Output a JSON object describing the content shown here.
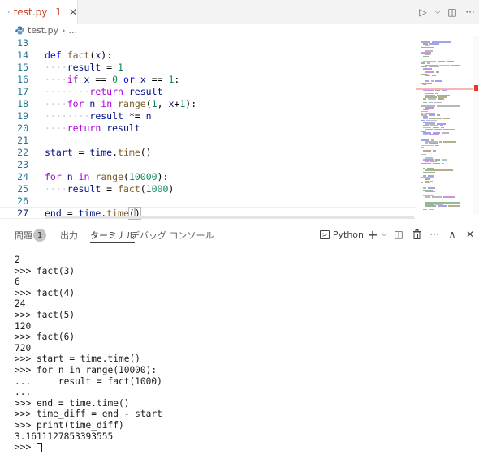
{
  "tab": {
    "label": "test.py",
    "badge": "1",
    "close": "✕"
  },
  "breadcrumb": {
    "file": "test.py",
    "separator": "›",
    "rest": "..."
  },
  "editor_actions": {
    "run": "▷",
    "run_dropdown": "⌵",
    "split": "◫",
    "more": "···"
  },
  "editor": {
    "lines": [
      {
        "num": "13",
        "html": ""
      },
      {
        "num": "14",
        "html": "<span class=\"kw\">def</span> <span class=\"fn\">fact</span>(<span class=\"var\">x</span>):"
      },
      {
        "num": "15",
        "html": "<span class=\"ws\">····</span><span class=\"var\">result</span> = <span class=\"numl\">1</span>"
      },
      {
        "num": "16",
        "html": "<span class=\"ws\">····</span><span class=\"ctl\">if</span> <span class=\"var\">x</span> == <span class=\"numl\">0</span> <span class=\"kw\">or</span> <span class=\"var\">x</span> == <span class=\"numl\">1</span>:"
      },
      {
        "num": "17",
        "html": "<span class=\"ws\">········</span><span class=\"ctl\">return</span> <span class=\"var\">result</span>"
      },
      {
        "num": "18",
        "html": "<span class=\"ws\">····</span><span class=\"ctl\">for</span> <span class=\"var\">n</span> <span class=\"ctl\">in</span> <span class=\"fn\">range</span>(<span class=\"numl\">1</span>, <span class=\"var\">x</span>+<span class=\"numl\">1</span>):"
      },
      {
        "num": "19",
        "html": "<span class=\"ws\">········</span><span class=\"var\">result</span> *= <span class=\"var\">n</span>"
      },
      {
        "num": "20",
        "html": "<span class=\"ws\">····</span><span class=\"ctl\">return</span> <span class=\"var\">result</span>"
      },
      {
        "num": "21",
        "html": ""
      },
      {
        "num": "22",
        "html": "<span class=\"var\">start</span> = <span class=\"var\">time</span>.<span class=\"fn\">time</span>()"
      },
      {
        "num": "23",
        "html": ""
      },
      {
        "num": "24",
        "html": "<span class=\"ctl\">for</span> <span class=\"var\">n</span> <span class=\"ctl\">in</span> <span class=\"fn\">range</span>(<span class=\"numl\">10000</span>):"
      },
      {
        "num": "25",
        "html": "<span class=\"ws\">····</span><span class=\"var\">result</span> = <span class=\"fn\">fact</span>(<span class=\"numl\">1000</span>)"
      },
      {
        "num": "26",
        "html": ""
      },
      {
        "num": "27",
        "html": "<span class=\"var\">end</span> = <span class=\"var\">time</span>.<span class=\"fn\">time</span><span class=\"bracket-hl\">(</span><span class=\"bracket-hl\">)</span><span class=\"cursor\"></span>"
      }
    ]
  },
  "panel": {
    "tabs": [
      {
        "label": "問題",
        "active": false
      },
      {
        "label": "出力",
        "active": false
      },
      {
        "label": "ターミナル",
        "active": true
      },
      {
        "label": "デバッグ コンソール",
        "active": false
      }
    ],
    "problems_count": "1",
    "terminal_kind": "Python",
    "actions": {
      "add": "+",
      "add_dropdown": "⌵",
      "split": "◫",
      "trash": "🗑",
      "more": "···",
      "maximize": "∧",
      "close": "✕"
    }
  },
  "terminal": {
    "lines": [
      "2",
      ">>> fact(3)",
      "6",
      ">>> fact(4)",
      "24",
      ">>> fact(5)",
      "120",
      ">>> fact(6)",
      "720",
      ">>> start = time.time()",
      ">>> for n in range(10000):",
      "...     result = fact(1000)",
      "...",
      ">>> end = time.time()",
      ">>> time_diff = end - start",
      ">>> print(time_diff)",
      "3.1611127853393555"
    ],
    "prompt": ">>> "
  }
}
